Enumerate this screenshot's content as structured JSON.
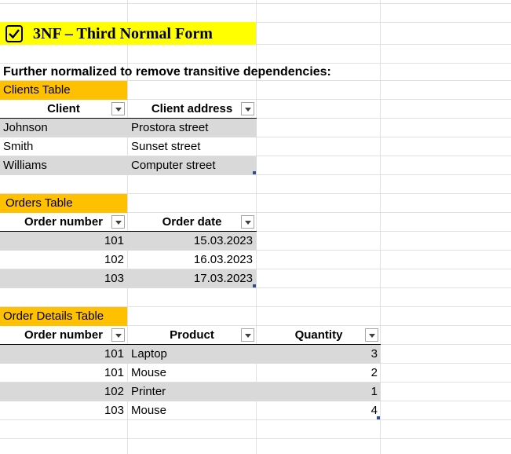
{
  "title": "3NF – Third Normal Form",
  "heading": "Further normalized to remove transitive dependencies:",
  "clients_table": {
    "label": "Clients Table",
    "headers": [
      "Client",
      "Client address"
    ],
    "rows": [
      {
        "client": "Johnson",
        "address": "Prostora street"
      },
      {
        "client": "Smith",
        "address": "Sunset street"
      },
      {
        "client": "Williams",
        "address": "Computer street"
      }
    ]
  },
  "orders_table": {
    "label": "Orders Table",
    "headers": [
      "Order number",
      "Order date"
    ],
    "rows": [
      {
        "order_number": "101",
        "order_date": "15.03.2023"
      },
      {
        "order_number": "102",
        "order_date": "16.03.2023"
      },
      {
        "order_number": "103",
        "order_date": "17.03.2023"
      }
    ]
  },
  "order_details_table": {
    "label": "Order Details Table",
    "headers": [
      "Order number",
      "Product",
      "Quantity"
    ],
    "rows": [
      {
        "order_number": "101",
        "product": "Laptop",
        "quantity": "3"
      },
      {
        "order_number": "101",
        "product": "Mouse",
        "quantity": "2"
      },
      {
        "order_number": "102",
        "product": "Printer",
        "quantity": "1"
      },
      {
        "order_number": "103",
        "product": "Mouse",
        "quantity": "4"
      }
    ]
  },
  "colors": {
    "title_fill": "#ffff00",
    "table_label_fill": "#ffc000",
    "band_fill": "#d9d9d9"
  },
  "icons": {
    "title_icon": "checkbox-checked-icon",
    "filter_icon": "dropdown-arrow-icon"
  }
}
